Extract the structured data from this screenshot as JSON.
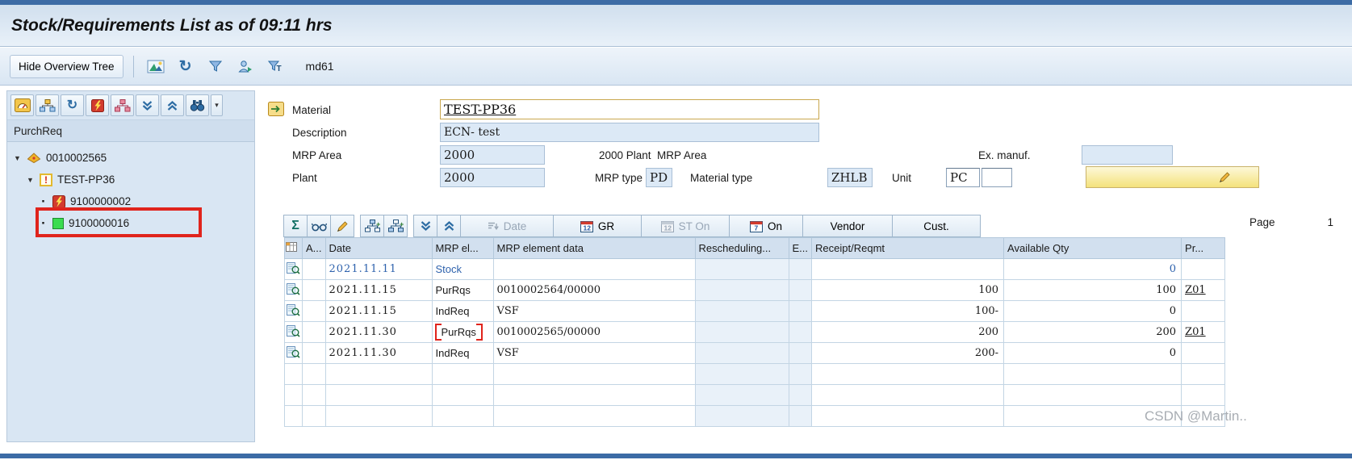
{
  "window": {
    "title": "Stock/Requirements List as of 09:11 hrs"
  },
  "app_toolbar": {
    "hide_overview_tree": "Hide Overview Tree",
    "transaction_code": "md61"
  },
  "tree_panel": {
    "header": "PurchReq",
    "items": [
      {
        "label": "0010002565",
        "icon": "order-icon"
      },
      {
        "label": "TEST-PP36",
        "icon": "warning-icon"
      },
      {
        "label": "9100000002",
        "icon": "flash-icon"
      },
      {
        "label": "9100000016",
        "icon": "green-square-icon",
        "annotated": true
      }
    ]
  },
  "form": {
    "material": {
      "label": "Material",
      "value": "TEST-PP36"
    },
    "description": {
      "label": "Description",
      "value": "ECN- test"
    },
    "mrp_area": {
      "label": "MRP Area",
      "value": "2000",
      "info": "2000 Plant  MRP Area"
    },
    "ex_manuf": {
      "label": "Ex. manuf.",
      "value": ""
    },
    "plant": {
      "label": "Plant",
      "value": "2000"
    },
    "mrp_type": {
      "label": "MRP type",
      "value": "PD"
    },
    "material_type": {
      "label": "Material type",
      "value": "ZHLB"
    },
    "unit": {
      "label": "Unit",
      "value": "PC",
      "value2": ""
    }
  },
  "grid_toolbar": {
    "date": "Date",
    "gr": "GR",
    "st_on": "ST On",
    "on": "On",
    "vendor": "Vendor",
    "cust": "Cust.",
    "page_label": "Page",
    "page_value": "1"
  },
  "grid": {
    "columns": [
      "A...",
      "Date",
      "MRP el...",
      "MRP element data",
      "Rescheduling...",
      "E...",
      "Receipt/Reqmt",
      "Available Qty",
      "Pr..."
    ],
    "rows": [
      {
        "date": "2021.11.11",
        "mrp_element": "Stock",
        "element_data": "",
        "rescheduling": "",
        "exception": "",
        "receipt_reqmt": "",
        "available_qty": "0",
        "pr": ""
      },
      {
        "date": "2021.11.15",
        "mrp_element": "PurRqs",
        "element_data": "0010002564/00000",
        "rescheduling": "",
        "exception": "",
        "receipt_reqmt": "100",
        "available_qty": "100",
        "pr": "Z01"
      },
      {
        "date": "2021.11.15",
        "mrp_element": "IndReq",
        "element_data": "VSF",
        "rescheduling": "",
        "exception": "",
        "receipt_reqmt": "100-",
        "available_qty": "0",
        "pr": ""
      },
      {
        "date": "2021.11.30",
        "mrp_element": "PurRqs",
        "element_data": "0010002565/00000",
        "rescheduling": "",
        "exception": "",
        "receipt_reqmt": "200",
        "available_qty": "200",
        "pr": "Z01"
      },
      {
        "date": "2021.11.30",
        "mrp_element": "IndReq",
        "element_data": "VSF",
        "rescheduling": "",
        "exception": "",
        "receipt_reqmt": "200-",
        "available_qty": "0",
        "pr": ""
      }
    ]
  },
  "icons": {
    "sigma": "Σ",
    "refresh": "↻",
    "expander": "▼",
    "bullet": "·",
    "warning": "!",
    "dropdown": "▾",
    "letter_t": "T",
    "plus": "+",
    "cal_gr": "12",
    "cal_st": "12",
    "cal_on": "7"
  },
  "colors": {
    "annotation_red": "#e0241c",
    "stock_blue": "#2e62ad",
    "accent_yellow": "#f6e074"
  },
  "watermark": "CSDN @Martin.."
}
